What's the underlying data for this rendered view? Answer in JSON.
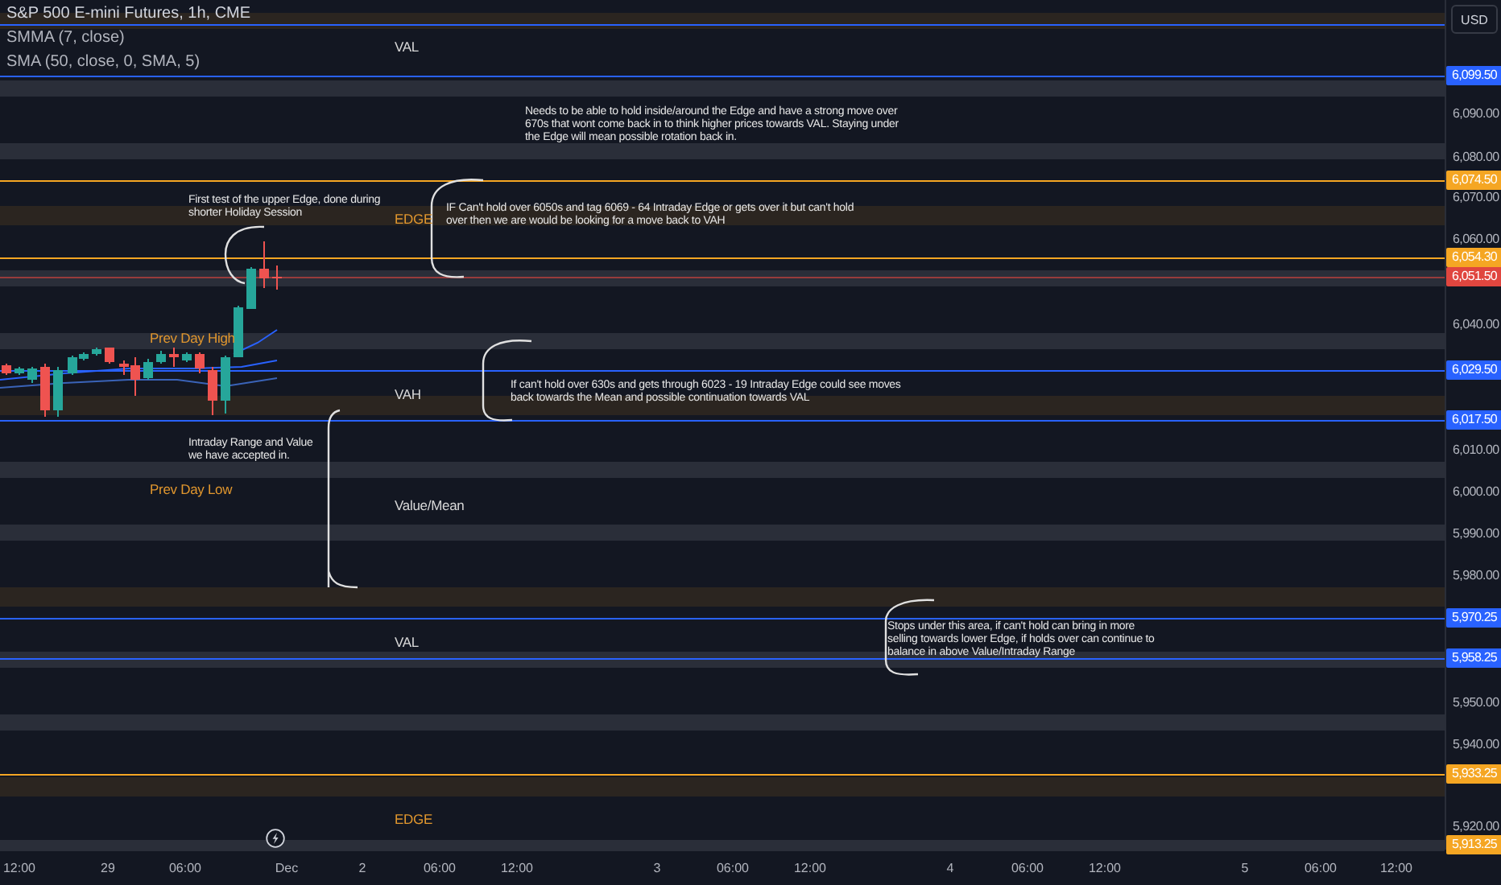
{
  "legend": [
    "S&P 500 E-mini Futures, 1h, CME",
    "SMMA (7, close)",
    "SMA (50, close, 0, SMA, 5)"
  ],
  "currency_button": "USD",
  "annotations": [
    {
      "kind": "level",
      "text": "VAL"
    },
    {
      "kind": "note",
      "text": "Needs to be able to hold inside/around the Edge and have a strong move over 670s that wont come back in to think higher prices towards VAL. Staying under the Edge will mean possible rotation back in."
    },
    {
      "kind": "note",
      "text": "First test of the upper Edge, done during shorter Holiday Session"
    },
    {
      "kind": "edge",
      "text": "EDGE"
    },
    {
      "kind": "note",
      "text": "IF Can't hold over 6050s and tag 6069 - 64 Intraday Edge or gets over it but can't hold over then we are would be looking for a move back to VAH"
    },
    {
      "kind": "edge",
      "text": "Prev Day High"
    },
    {
      "kind": "level",
      "text": "VAH"
    },
    {
      "kind": "note",
      "text": "If can't hold over 630s and gets through 6023 - 19 Intraday Edge could see moves back towards the Mean and possible continuation towards VAL"
    },
    {
      "kind": "note",
      "text": "Intraday Range and Value we have accepted in."
    },
    {
      "kind": "edge",
      "text": "Prev Day Low"
    },
    {
      "kind": "level",
      "text": "Value/Mean"
    },
    {
      "kind": "level",
      "text": "VAL"
    },
    {
      "kind": "note",
      "text": "Stops under this area, if can't hold can bring in more selling towards lower Edge, if holds over can continue to balance in above Value/Intraday Range"
    },
    {
      "kind": "edge",
      "text": "EDGE"
    }
  ],
  "price_ticks": [
    "6,090.00",
    "6,080.00",
    "6,070.00",
    "6,060.00",
    "6,040.00",
    "6,010.00",
    "6,000.00",
    "5,990.00",
    "5,980.00",
    "5,950.00",
    "5,940.00",
    "5,920.00"
  ],
  "price_tags": [
    {
      "text": "6,099.50",
      "color": "#2962ff"
    },
    {
      "text": "6,074.50",
      "color": "#f5a623"
    },
    {
      "text": "6,054.30",
      "color": "#f5a623"
    },
    {
      "text": "6,051.50",
      "color": "#e0463f"
    },
    {
      "text": "6,029.50",
      "color": "#2962ff"
    },
    {
      "text": "6,017.50",
      "color": "#2962ff"
    },
    {
      "text": "5,970.25",
      "color": "#2962ff"
    },
    {
      "text": "5,958.25",
      "color": "#2962ff"
    },
    {
      "text": "5,933.25",
      "color": "#f5a623"
    },
    {
      "text": "5,913.25",
      "color": "#f5a623"
    }
  ],
  "time_labels": [
    "12:00",
    "29",
    "06:00",
    "Dec",
    "2",
    "06:00",
    "12:00",
    "3",
    "06:00",
    "12:00",
    "4",
    "06:00",
    "12:00",
    "5",
    "06:00",
    "12:00"
  ]
}
